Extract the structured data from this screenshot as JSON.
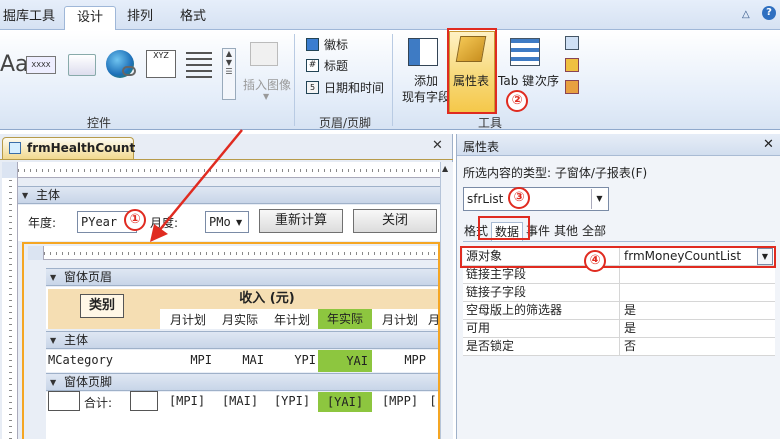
{
  "ribbon": {
    "tabs": [
      {
        "label": "掘库工具",
        "active": false
      },
      {
        "label": "设计",
        "active": true
      },
      {
        "label": "排列",
        "active": false
      },
      {
        "label": "格式",
        "active": false
      }
    ],
    "controls_group_label": "控件",
    "insert_image_label": "插入图像",
    "header_footer": {
      "logo_label": "徽标",
      "title_label": "标题",
      "datetime_label": "日期和时间",
      "group_label": "页眉/页脚"
    },
    "tools": {
      "add_existing_fields_line1": "添加",
      "add_existing_fields_line2": "现有字段",
      "property_sheet_label": "属性表",
      "tab_order_line1": "Tab 键",
      "tab_order_line2": "次序",
      "group_label": "工具"
    },
    "aa_glyph": "Aa",
    "xxxx_glyph": "XXXX",
    "xyz_glyph": "XYZ"
  },
  "designer": {
    "document_tab": "frmHealthCount",
    "main_section": "主体",
    "year_label": "年度:",
    "year_value": "PYear",
    "month_label": "月度:",
    "month_value": "PMo",
    "recalc_button": "重新计算",
    "close_button": "关闭",
    "subform": {
      "header_section": "窗体页眉",
      "category_header": "类别",
      "income_header": "收入 (元)",
      "columns": [
        "月计划",
        "月实际",
        "年计划",
        "年实际",
        "月计划",
        "月"
      ],
      "detail_section": "主体",
      "detail_fields": [
        "MCategory",
        "MPI",
        "MAI",
        "YPI",
        "YAI",
        "MPP"
      ],
      "footer_section": "窗体页脚",
      "total_label": "合计:",
      "total_fields": [
        "[MPI]",
        "[MAI]",
        "[YPI]",
        "[YAI]",
        "[MPP]",
        "["
      ]
    }
  },
  "property_sheet": {
    "title": "属性表",
    "selection_type_label": "所选内容的类型: 子窗体/子报表(F)",
    "selected_object": "sfrList",
    "tabs": [
      "格式",
      "数据",
      "事件",
      "其他",
      "全部"
    ],
    "active_tab": "数据",
    "rows": [
      {
        "key": "源对象",
        "value": "frmMoneyCountList"
      },
      {
        "key": "链接主字段",
        "value": ""
      },
      {
        "key": "链接子字段",
        "value": ""
      },
      {
        "key": "空母版上的筛选器",
        "value": "是"
      },
      {
        "key": "可用",
        "value": "是"
      },
      {
        "key": "是否锁定",
        "value": "否"
      }
    ]
  },
  "annotations": [
    "①",
    "②",
    "③",
    "④"
  ],
  "colors": {
    "highlight": "#8dc63f",
    "annotation": "#e02b20",
    "property_button": "#f7d97a"
  }
}
